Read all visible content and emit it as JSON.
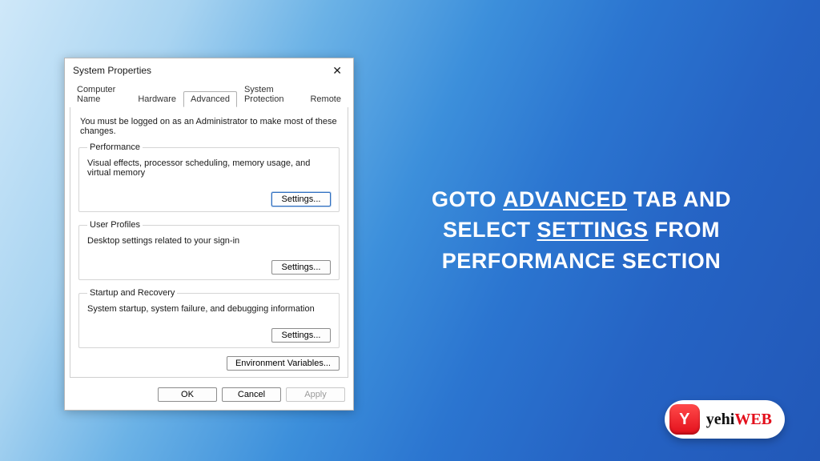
{
  "dialog": {
    "title": "System Properties",
    "close_glyph": "✕",
    "tabs": [
      {
        "label": "Computer Name"
      },
      {
        "label": "Hardware"
      },
      {
        "label": "Advanced"
      },
      {
        "label": "System Protection"
      },
      {
        "label": "Remote"
      }
    ],
    "admin_note": "You must be logged on as an Administrator to make most of these changes.",
    "groups": {
      "performance": {
        "legend": "Performance",
        "desc": "Visual effects, processor scheduling, memory usage, and virtual memory",
        "button": "Settings..."
      },
      "user_profiles": {
        "legend": "User Profiles",
        "desc": "Desktop settings related to your sign-in",
        "button": "Settings..."
      },
      "startup": {
        "legend": "Startup and Recovery",
        "desc": "System startup, system failure, and debugging information",
        "button": "Settings..."
      }
    },
    "env_button": "Environment Variables...",
    "actions": {
      "ok": "OK",
      "cancel": "Cancel",
      "apply": "Apply"
    }
  },
  "instruction": {
    "pre1": "GOTO ",
    "u1": "ADVANCED",
    "post1": " TAB AND",
    "pre2": "SELECT ",
    "u2": "SETTINGS",
    "post2": " FROM",
    "line3": "PERFORMANCE SECTION"
  },
  "logo": {
    "badge_letter": "Y",
    "part1": "yehi",
    "part2": "WEB"
  }
}
